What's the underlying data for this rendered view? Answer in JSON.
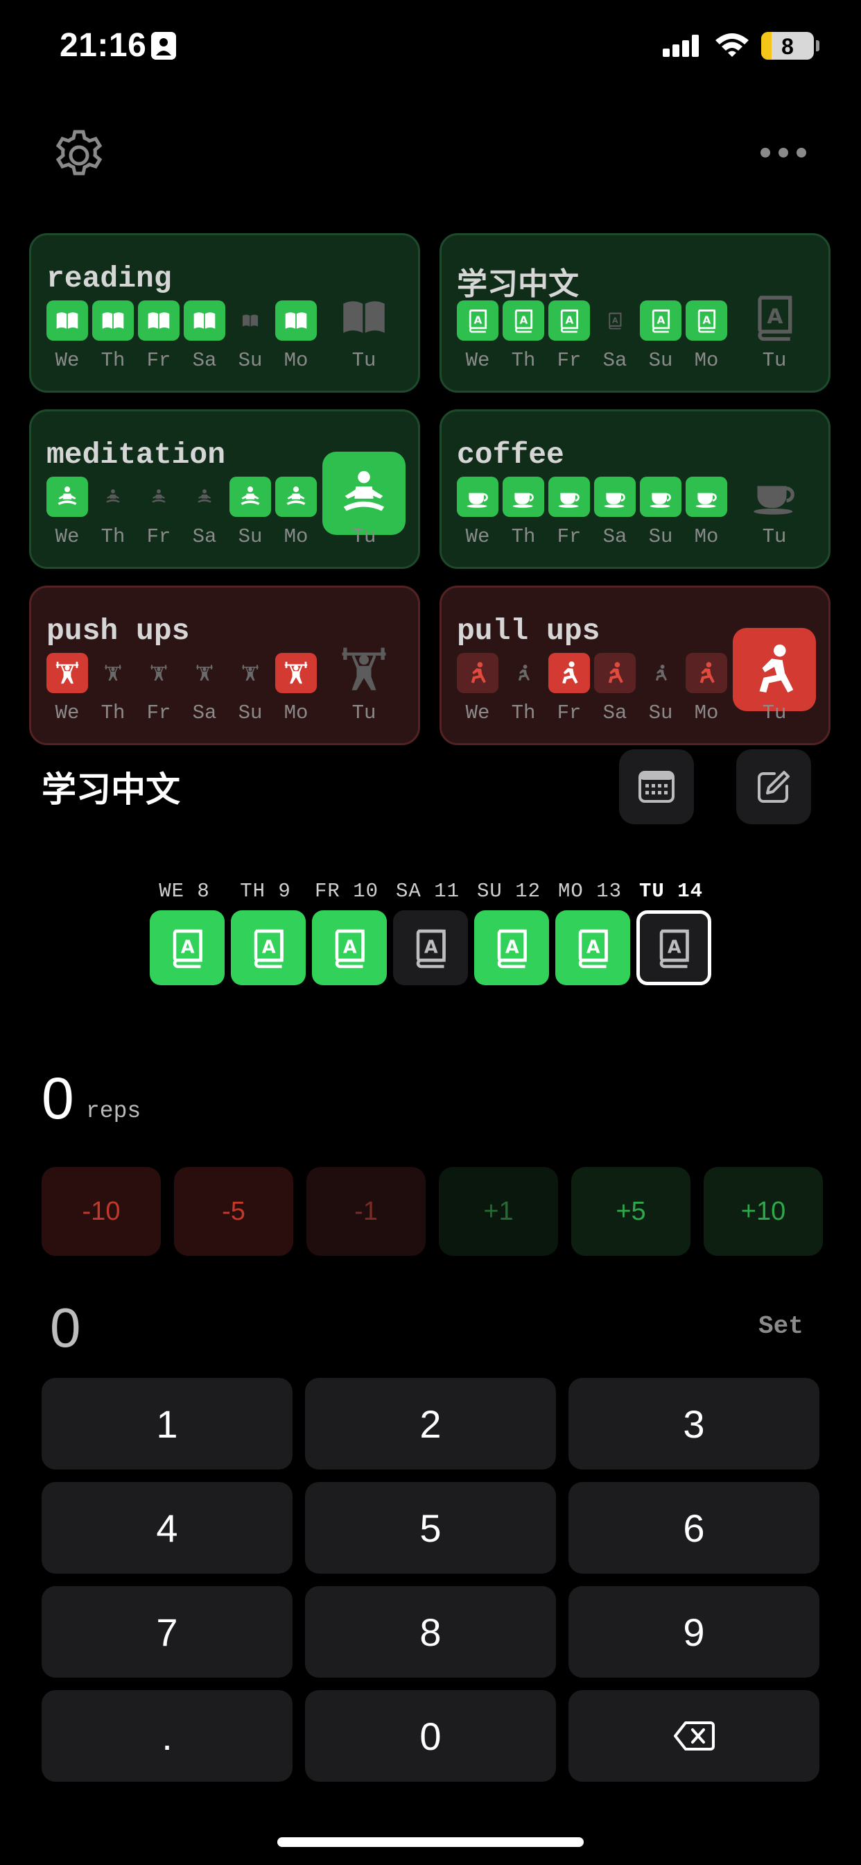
{
  "status_bar": {
    "time": "21:16",
    "battery": "8"
  },
  "habits": [
    {
      "name": "reading",
      "color": "green",
      "icon": "book-open-icon",
      "days": [
        {
          "label": "We",
          "state": "done"
        },
        {
          "label": "Th",
          "state": "done"
        },
        {
          "label": "Fr",
          "state": "done"
        },
        {
          "label": "Sa",
          "state": "done"
        },
        {
          "label": "Su",
          "state": "none"
        },
        {
          "label": "Mo",
          "state": "done"
        }
      ],
      "today": {
        "label": "Tu",
        "state": "none"
      }
    },
    {
      "name": "学习中文",
      "color": "green",
      "icon": "dictionary-icon",
      "days": [
        {
          "label": "We",
          "state": "done"
        },
        {
          "label": "Th",
          "state": "done"
        },
        {
          "label": "Fr",
          "state": "done"
        },
        {
          "label": "Sa",
          "state": "none"
        },
        {
          "label": "Su",
          "state": "done"
        },
        {
          "label": "Mo",
          "state": "done"
        }
      ],
      "today": {
        "label": "Tu",
        "state": "none"
      }
    },
    {
      "name": "meditation",
      "color": "green",
      "icon": "meditation-icon",
      "days": [
        {
          "label": "We",
          "state": "done"
        },
        {
          "label": "Th",
          "state": "none"
        },
        {
          "label": "Fr",
          "state": "none"
        },
        {
          "label": "Sa",
          "state": "none"
        },
        {
          "label": "Su",
          "state": "done"
        },
        {
          "label": "Mo",
          "state": "done"
        }
      ],
      "today": {
        "label": "Tu",
        "state": "done"
      }
    },
    {
      "name": "coffee",
      "color": "green",
      "icon": "coffee-cup-icon",
      "days": [
        {
          "label": "We",
          "state": "done"
        },
        {
          "label": "Th",
          "state": "done"
        },
        {
          "label": "Fr",
          "state": "done"
        },
        {
          "label": "Sa",
          "state": "done"
        },
        {
          "label": "Su",
          "state": "done"
        },
        {
          "label": "Mo",
          "state": "done"
        }
      ],
      "today": {
        "label": "Tu",
        "state": "none"
      }
    },
    {
      "name": "push ups",
      "color": "red",
      "icon": "weightlifting-icon",
      "days": [
        {
          "label": "We",
          "state": "done"
        },
        {
          "label": "Th",
          "state": "none"
        },
        {
          "label": "Fr",
          "state": "none"
        },
        {
          "label": "Sa",
          "state": "none"
        },
        {
          "label": "Su",
          "state": "none"
        },
        {
          "label": "Mo",
          "state": "done"
        }
      ],
      "today": {
        "label": "Tu",
        "state": "none"
      }
    },
    {
      "name": "pull ups",
      "color": "red",
      "icon": "lunge-figure-icon",
      "days": [
        {
          "label": "We",
          "state": "partial"
        },
        {
          "label": "Th",
          "state": "none"
        },
        {
          "label": "Fr",
          "state": "done"
        },
        {
          "label": "Sa",
          "state": "partial"
        },
        {
          "label": "Su",
          "state": "none"
        },
        {
          "label": "Mo",
          "state": "partial"
        }
      ],
      "today": {
        "label": "Tu",
        "state": "done"
      }
    }
  ],
  "detail": {
    "title": "学习中文",
    "week": [
      {
        "label": "WE 8",
        "state": "done"
      },
      {
        "label": "TH 9",
        "state": "done"
      },
      {
        "label": "FR 10",
        "state": "done"
      },
      {
        "label": "SA 11",
        "state": "missed"
      },
      {
        "label": "SU 12",
        "state": "done"
      },
      {
        "label": "MO 13",
        "state": "done"
      },
      {
        "label": "TU 14",
        "state": "today"
      }
    ],
    "count": "0",
    "unit": "reps",
    "steps": [
      "-10",
      "-5",
      "-1",
      "+1",
      "+5",
      "+10"
    ],
    "input_value": "0",
    "set_label": "Set",
    "keys": [
      "1",
      "2",
      "3",
      "4",
      "5",
      "6",
      "7",
      "8",
      "9",
      ".",
      "0",
      ""
    ]
  },
  "colors": {
    "green": "#2fbf4e",
    "red": "#d33a32",
    "bright_green": "#32d15a"
  }
}
